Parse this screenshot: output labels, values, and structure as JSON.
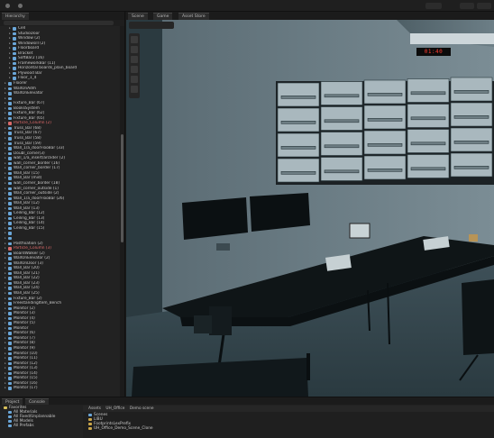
{
  "toolbar": {
    "title": ""
  },
  "hierarchy": {
    "tab_label": "Hierarchy",
    "items": [
      {
        "label": "Cell",
        "red": false,
        "depth": 2
      },
      {
        "label": "StudioDoor",
        "red": false,
        "depth": 2
      },
      {
        "label": "Window (2)",
        "red": false,
        "depth": 2
      },
      {
        "label": "Windowsill (2)",
        "red": false,
        "depth": 2
      },
      {
        "label": "Floorboard",
        "red": false,
        "depth": 2
      },
      {
        "label": "Bracket",
        "red": false,
        "depth": 2
      },
      {
        "label": "SoftBar2 (16)",
        "red": false,
        "depth": 2
      },
      {
        "label": "FrameworkBar (11)",
        "red": false,
        "depth": 2
      },
      {
        "label": "Horizontal boards_plain_board",
        "red": false,
        "depth": 2
      },
      {
        "label": "Plywood Bar",
        "red": false,
        "depth": 2
      },
      {
        "label": "Floor_1_4",
        "red": false,
        "depth": 2
      },
      {
        "label": "Floorer",
        "red": false,
        "depth": 1
      },
      {
        "label": "WallOnAdm",
        "red": false,
        "depth": 1
      },
      {
        "label": "WallOnElevator",
        "red": false,
        "depth": 1
      },
      {
        "label": "",
        "red": false,
        "depth": 1
      },
      {
        "label": "Fixture_Bar (67)",
        "red": false,
        "depth": 1
      },
      {
        "label": "BooksSystem",
        "red": false,
        "depth": 1
      },
      {
        "label": "Fixture_Bar (62)",
        "red": false,
        "depth": 1
      },
      {
        "label": "Fixture_Bar (65)",
        "red": false,
        "depth": 1
      },
      {
        "label": "Particle_Column (2)",
        "red": true,
        "depth": 1
      },
      {
        "label": "Truss_Bar (68)",
        "red": false,
        "depth": 1
      },
      {
        "label": "Truss_Bar (67)",
        "red": false,
        "depth": 1
      },
      {
        "label": "Truss_Bar (58)",
        "red": false,
        "depth": 1
      },
      {
        "label": "Truss_Bar (59)",
        "red": false,
        "depth": 1
      },
      {
        "label": "Wall_1/a_doorFlooBar (33)",
        "red": false,
        "depth": 1
      },
      {
        "label": "Doubl_corner(3)",
        "red": false,
        "depth": 1
      },
      {
        "label": "wall_1/a_insert/arclider (2)",
        "red": false,
        "depth": 1
      },
      {
        "label": "wall_corner_border (16)",
        "red": false,
        "depth": 1
      },
      {
        "label": "Wall_corner_border (17)",
        "red": false,
        "depth": 1
      },
      {
        "label": "Wall_Bar (15)",
        "red": false,
        "depth": 1
      },
      {
        "label": "Wall_Bar (mid)",
        "red": false,
        "depth": 1
      },
      {
        "label": "wall_corner_border (18)",
        "red": false,
        "depth": 1
      },
      {
        "label": "wall_corner_outside (1)",
        "red": false,
        "depth": 1
      },
      {
        "label": "Wall_corner_outside (2)",
        "red": false,
        "depth": 1
      },
      {
        "label": "Wall_1/a_doorFlooBar (26)",
        "red": false,
        "depth": 1
      },
      {
        "label": "Wall_Bar (12)",
        "red": false,
        "depth": 1
      },
      {
        "label": "Wall_Bar (13)",
        "red": false,
        "depth": 1
      },
      {
        "label": "Ceiling_Bar (12)",
        "red": false,
        "depth": 1
      },
      {
        "label": "Ceiling_Bar (13)",
        "red": false,
        "depth": 1
      },
      {
        "label": "Ceiling_Bar (14)",
        "red": false,
        "depth": 1
      },
      {
        "label": "Ceiling_Bar (15)",
        "red": false,
        "depth": 1
      },
      {
        "label": "",
        "red": false,
        "depth": 1
      },
      {
        "label": "",
        "red": false,
        "depth": 1
      },
      {
        "label": "Postfixation (2)",
        "red": false,
        "depth": 1
      },
      {
        "label": "Particle_Column (3)",
        "red": true,
        "depth": 1
      },
      {
        "label": "BoardWalker (2)",
        "red": false,
        "depth": 1
      },
      {
        "label": "WallOnElevator (2)",
        "red": false,
        "depth": 1
      },
      {
        "label": "WallOnDoor (3)",
        "red": false,
        "depth": 1
      },
      {
        "label": "Wall_Bar (20)",
        "red": false,
        "depth": 1
      },
      {
        "label": "Wall_Bar (21)",
        "red": false,
        "depth": 1
      },
      {
        "label": "Wall_Bar (22)",
        "red": false,
        "depth": 1
      },
      {
        "label": "Wall_Bar (23)",
        "red": false,
        "depth": 1
      },
      {
        "label": "Wall_Bar (24)",
        "red": false,
        "depth": 1
      },
      {
        "label": "Wall_Bar (25)",
        "red": false,
        "depth": 1
      },
      {
        "label": "Fixture_Bar (2)",
        "red": false,
        "depth": 1
      },
      {
        "label": "FreestandingItem_Bench",
        "red": false,
        "depth": 1
      },
      {
        "label": "Monitor (2)",
        "red": false,
        "depth": 1
      },
      {
        "label": "Monitor (3)",
        "red": false,
        "depth": 1
      },
      {
        "label": "Monitor (4)",
        "red": false,
        "depth": 1
      },
      {
        "label": "Monitor (5)",
        "red": false,
        "depth": 1
      },
      {
        "label": "Monitor",
        "red": false,
        "depth": 1
      },
      {
        "label": "Monitor (6)",
        "red": false,
        "depth": 1
      },
      {
        "label": "Monitor (7)",
        "red": false,
        "depth": 1
      },
      {
        "label": "Monitor (8)",
        "red": false,
        "depth": 1
      },
      {
        "label": "Monitor (9)",
        "red": false,
        "depth": 1
      },
      {
        "label": "Monitor (10)",
        "red": false,
        "depth": 1
      },
      {
        "label": "Monitor (11)",
        "red": false,
        "depth": 1
      },
      {
        "label": "Monitor (12)",
        "red": false,
        "depth": 1
      },
      {
        "label": "Monitor (13)",
        "red": false,
        "depth": 1
      },
      {
        "label": "Monitor (14)",
        "red": false,
        "depth": 1
      },
      {
        "label": "Monitor (15)",
        "red": false,
        "depth": 1
      },
      {
        "label": "Monitor (16)",
        "red": false,
        "depth": 1
      },
      {
        "label": "Monitor (17)",
        "red": false,
        "depth": 1
      }
    ]
  },
  "scene": {
    "tabs": [
      "Scene",
      "Game",
      "Asset Store"
    ],
    "clock": "01:40"
  },
  "project": {
    "tabs": [
      "Project",
      "Console"
    ],
    "favorites_label": "Favorites",
    "favorites": [
      "All Materials",
      "All Fixed/Unplannable",
      "All Models",
      "All Prefabs"
    ],
    "breadcrumb": [
      "Assets",
      "UH_Office",
      "Demo scene"
    ],
    "assets": [
      "Scenes",
      "LIBU",
      "FootprintsLexPrefix",
      "UH_Office_Demo_Scene_Clone"
    ]
  },
  "colors": {
    "accent": "#3d6fb4",
    "hier_icon": "#6aa6d8",
    "warning_text": "#e06a6a",
    "clock": "#ff3b2f"
  }
}
